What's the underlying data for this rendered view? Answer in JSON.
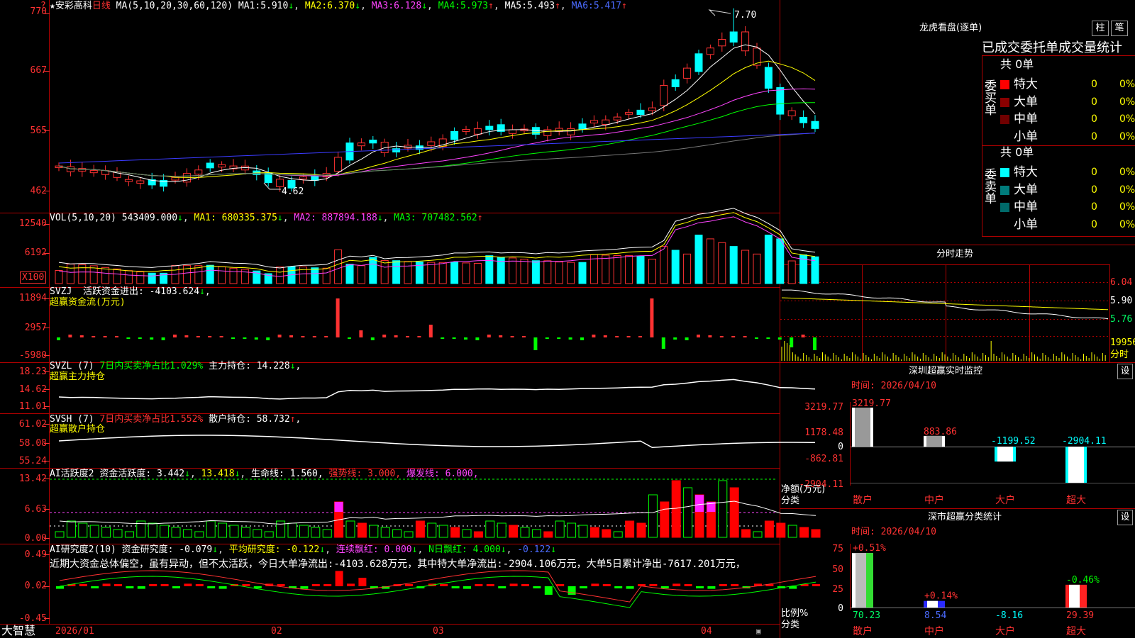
{
  "colors": {
    "up": "#ff3232",
    "down": "#00ffff",
    "ma1": "#ffffff",
    "ma2": "#ffff00",
    "ma3": "#ff44ff",
    "ma4": "#00ff00",
    "ma5": "#777777",
    "ma6": "#3b3bff",
    "frame": "#b00000",
    "bg": "#000000"
  },
  "stock": {
    "name": "★安彩高科",
    "period": "日线",
    "ma_set": "MA(5,10,20,30,60,120)"
  },
  "ma": [
    {
      "label": "MA1:",
      "value": "5.910",
      "arrow": "↓"
    },
    {
      "label": "MA2:",
      "value": "6.370",
      "arrow": "↓"
    },
    {
      "label": "MA3:",
      "value": "6.128",
      "arrow": "↓"
    },
    {
      "label": "MA4:",
      "value": "5.973",
      "arrow": "↑"
    },
    {
      "label": "MA5:",
      "value": "5.493",
      "arrow": "↑"
    },
    {
      "label": "MA6:",
      "value": "5.417",
      "arrow": "↑"
    }
  ],
  "price_axis": [
    "770",
    "667",
    "565",
    "462"
  ],
  "price_ann": {
    "high": "7.70",
    "low": "4.62"
  },
  "vol": {
    "header": "VOL(5,10,20)",
    "value": "543409.000",
    "v_arrow": "↓",
    "ma1": "MA1: 680335.375",
    "ma1_arrow": "↓",
    "ma2": "MA2: 887894.188",
    "ma2_arrow": "↓",
    "ma3": "MA3: 707482.562",
    "ma3_arrow": "↑",
    "axis": [
      "12540",
      "6192"
    ],
    "unit": "X100"
  },
  "svzj": {
    "header": "SVZJ",
    "label": "活跃资金进出:",
    "value": "-4103.624",
    "arrow": "↓",
    "sep": ",",
    "sub": "超赢资金流(万元)",
    "axis": [
      "11894",
      "2957",
      "-5980"
    ]
  },
  "svzl": {
    "header": "SVZL  (7)",
    "label": "7日内买卖净占比1.029%",
    "label2": "主力持仓:",
    "value": "14.228",
    "arrow": "↓",
    "sep": ",",
    "sub": "超赢主力持仓",
    "axis": [
      "18.23",
      "14.62",
      "11.01"
    ]
  },
  "svsh": {
    "header": "SVSH  (7)",
    "label": "7日内买卖净占比1.552%",
    "label2": "散户持仓:",
    "value": "58.732",
    "arrow": "↑",
    "sep": ",",
    "sub": "超赢散户持仓",
    "axis": [
      "61.02",
      "58.08",
      "55.24"
    ]
  },
  "ai1": {
    "header": "AI活跃度2",
    "label": "资金活跃度:",
    "value": "3.442",
    "arrow": "↓",
    "v2": "13.418",
    "v2_arrow": "↓",
    "life": "生命线: 1.560,",
    "strong": "强势线: 3.000,",
    "burst": "爆发线: 6.000,",
    "axis": [
      "13.42",
      "6.63",
      "0.00"
    ]
  },
  "ai2": {
    "header": "AI研究度2(10)",
    "label": "资金研究度:",
    "value": "-0.079",
    "arrow": "↓",
    "avg": "平均研究度: -0.122",
    "avg_arrow": "↓",
    "lian": "连续飘红: 0.000",
    "lian_arrow": "↓",
    "nday": "N日飘红: 4.000",
    "nday_arrow": "↓",
    "last": "-0.122",
    "last_arrow": "↓",
    "axis": [
      "0.49",
      "0.02",
      "-0.45"
    ],
    "comment": "近期大资金总体偏空，虽有异动，但不太活跃，今日大单净流出:-4103.628万元，其中特大单净流出:-2904.106万元，大单5日累计净出-7617.201万元，"
  },
  "dates": [
    "2026/01",
    "02",
    "03",
    "04"
  ],
  "logo": "大智慧",
  "dragon": {
    "title": "龙虎看盘(逐单)",
    "btn1": "柱",
    "btn2": "笔",
    "subtitle": "已成交委托单成交量统计",
    "buy": {
      "side": "委买单",
      "total": "共 0单",
      "rows": [
        {
          "name": "特大",
          "count": "0",
          "pct": "0%",
          "color": "#ff0000"
        },
        {
          "name": "大单",
          "count": "0",
          "pct": "0%",
          "color": "#8b0000"
        },
        {
          "name": "中单",
          "count": "0",
          "pct": "0%",
          "color": "#700000"
        },
        {
          "name": "小单",
          "count": "0",
          "pct": "0%",
          "color": "#000000"
        }
      ]
    },
    "sell": {
      "side": "委卖单",
      "total": "共 0单",
      "rows": [
        {
          "name": "特大",
          "count": "0",
          "pct": "0%",
          "color": "#00ffff"
        },
        {
          "name": "大单",
          "count": "0",
          "pct": "0%",
          "color": "#007c7c"
        },
        {
          "name": "中单",
          "count": "0",
          "pct": "0%",
          "color": "#006a6a"
        },
        {
          "name": "小单",
          "count": "0",
          "pct": "0%",
          "color": "#000000"
        }
      ]
    }
  },
  "intraday": {
    "title": "分时走势",
    "axis": [
      "6.04",
      "5.90",
      "5.76"
    ],
    "vol_label": "19956",
    "vol_unit": "分时"
  },
  "monitor": {
    "title": "深圳超赢实时监控",
    "btn": "设",
    "time_label": "时间: 2026/04/10",
    "axis": [
      "3219.77",
      "1178.48",
      "0",
      "-862.81",
      "-2904.11"
    ],
    "unit_label": "净额(万元)",
    "cat_label": "分类",
    "bars": [
      {
        "name": "散户",
        "value": 3219.77,
        "label": "3219.77"
      },
      {
        "name": "中户",
        "value": 883.86,
        "label": "883.86"
      },
      {
        "name": "大户",
        "value": -1199.52,
        "label": "-1199.52"
      },
      {
        "name": "超大",
        "value": -2904.11,
        "label": "-2904.11"
      }
    ]
  },
  "stats": {
    "title": "深市超赢分类统计",
    "btn": "设",
    "time_label": "时间: 2026/04/10",
    "axis": [
      "75",
      "50",
      "25",
      "0"
    ],
    "unit_label": "比例%",
    "cat_label": "分类",
    "bars": [
      {
        "name": "散户",
        "top": "+0.51%",
        "bottom": "70.23",
        "pct": 70.23
      },
      {
        "name": "中户",
        "top": "+0.14%",
        "bottom": "8.54",
        "pct": 8.54
      },
      {
        "name": "大户",
        "top": "",
        "bottom": "-8.16",
        "pct": 0
      },
      {
        "name": "超大",
        "top": "-0.46%",
        "bottom": "29.39",
        "pct": 29.39
      }
    ]
  },
  "chart_data": [
    {
      "type": "candlestick",
      "title": "★安彩高科 日线",
      "y_axis_ticks": [
        "770",
        "667",
        "565",
        "462"
      ],
      "annotations": [
        {
          "text": "7.70",
          "meaning": "period high"
        },
        {
          "text": "4.62",
          "meaning": "period low"
        }
      ],
      "x_ticks": [
        "2026/01",
        "02",
        "03",
        "04"
      ],
      "close_approx": [
        5.05,
        4.95,
        4.98,
        4.97,
        4.9,
        4.85,
        4.78,
        4.75,
        4.72,
        4.8,
        4.83,
        4.92,
        4.98,
        5.1,
        5.05,
        5.0,
        4.98,
        4.92,
        4.76,
        4.69,
        4.8,
        4.86,
        4.87,
        4.92,
        5.2,
        5.45,
        5.4,
        5.5,
        5.28,
        5.35,
        5.36,
        5.4,
        5.45,
        5.52,
        5.65,
        5.65,
        5.7,
        5.72,
        5.65,
        5.68,
        5.66,
        5.6,
        5.68,
        5.65,
        5.7,
        5.78,
        5.82,
        5.85,
        5.9,
        5.98,
        6.02,
        6.04,
        6.45,
        6.55,
        6.75,
        7.0,
        7.1,
        7.25,
        7.38,
        7.05,
        6.8,
        6.4,
        5.95,
        5.92,
        5.8,
        5.7
      ]
    },
    {
      "type": "bar",
      "title": "VOL(5,10,20)",
      "y_axis_ticks": [
        "12540",
        "6192"
      ],
      "unit": "X100"
    },
    {
      "type": "bar",
      "title": "超赢资金流(万元)",
      "y_axis_ticks": [
        "11894",
        "2957",
        "-5980"
      ]
    },
    {
      "type": "line",
      "title": "超赢主力持仓",
      "y_axis_ticks": [
        "18.23",
        "14.62",
        "11.01"
      ]
    },
    {
      "type": "line",
      "title": "超赢散户持仓",
      "y_axis_ticks": [
        "61.02",
        "58.08",
        "55.24"
      ]
    },
    {
      "type": "bar",
      "title": "AI活跃度2",
      "y_axis_ticks": [
        "13.42",
        "6.63",
        "0.00"
      ]
    },
    {
      "type": "bar",
      "title": "AI研究度2(10)",
      "y_axis_ticks": [
        "0.49",
        "0.02",
        "-0.45"
      ]
    },
    {
      "type": "bar",
      "title": "深圳超赢实时监控",
      "categories": [
        "散户",
        "中户",
        "大户",
        "超大"
      ],
      "values": [
        3219.77,
        883.86,
        -1199.52,
        -2904.11
      ],
      "ylabel": "净额(万元)"
    },
    {
      "type": "bar",
      "title": "深市超赢分类统计",
      "categories": [
        "散户",
        "中户",
        "大户",
        "超大"
      ],
      "values": [
        70.23,
        8.54,
        -8.16,
        29.39
      ],
      "changes": [
        "+0.51%",
        "+0.14%",
        "",
        "-0.46%"
      ],
      "ylabel": "比例%",
      "ylim": [
        0,
        75
      ]
    }
  ]
}
